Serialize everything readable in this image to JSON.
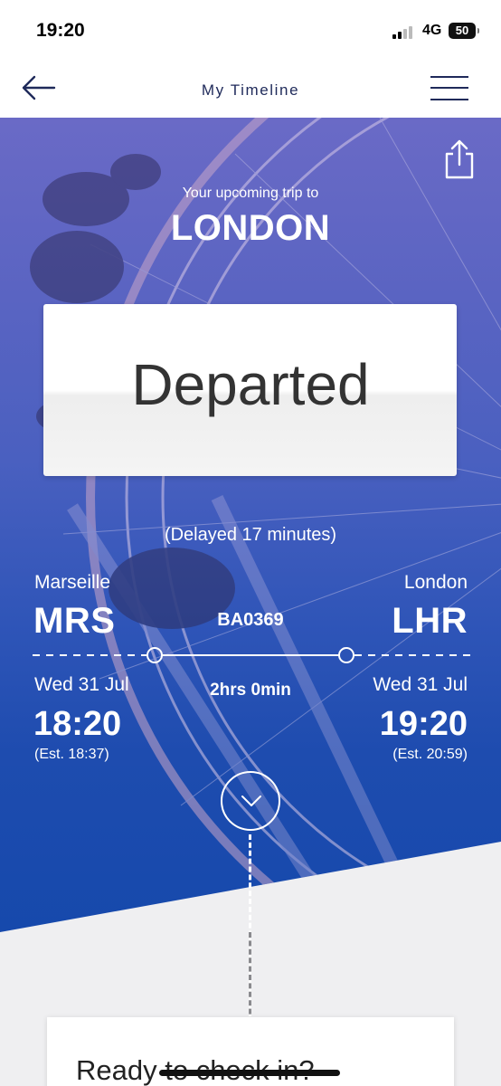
{
  "status_bar": {
    "time": "19:20",
    "network": "4G",
    "battery": "50"
  },
  "nav": {
    "title": "My Timeline"
  },
  "trip": {
    "subtitle": "Your upcoming trip to",
    "destination": "LONDON"
  },
  "flight": {
    "status": "Departed",
    "delay": "(Delayed 17 minutes)",
    "number": "BA0369",
    "duration": "2hrs 0min",
    "departure": {
      "city": "Marseille",
      "code": "MRS",
      "date": "Wed 31 Jul",
      "time": "18:20",
      "estimate": "(Est. 18:37)"
    },
    "arrival": {
      "city": "London",
      "code": "LHR",
      "date": "Wed 31 Jul",
      "time": "19:20",
      "estimate": "(Est. 20:59)"
    }
  },
  "checkin": {
    "title": "Ready to check in?"
  }
}
